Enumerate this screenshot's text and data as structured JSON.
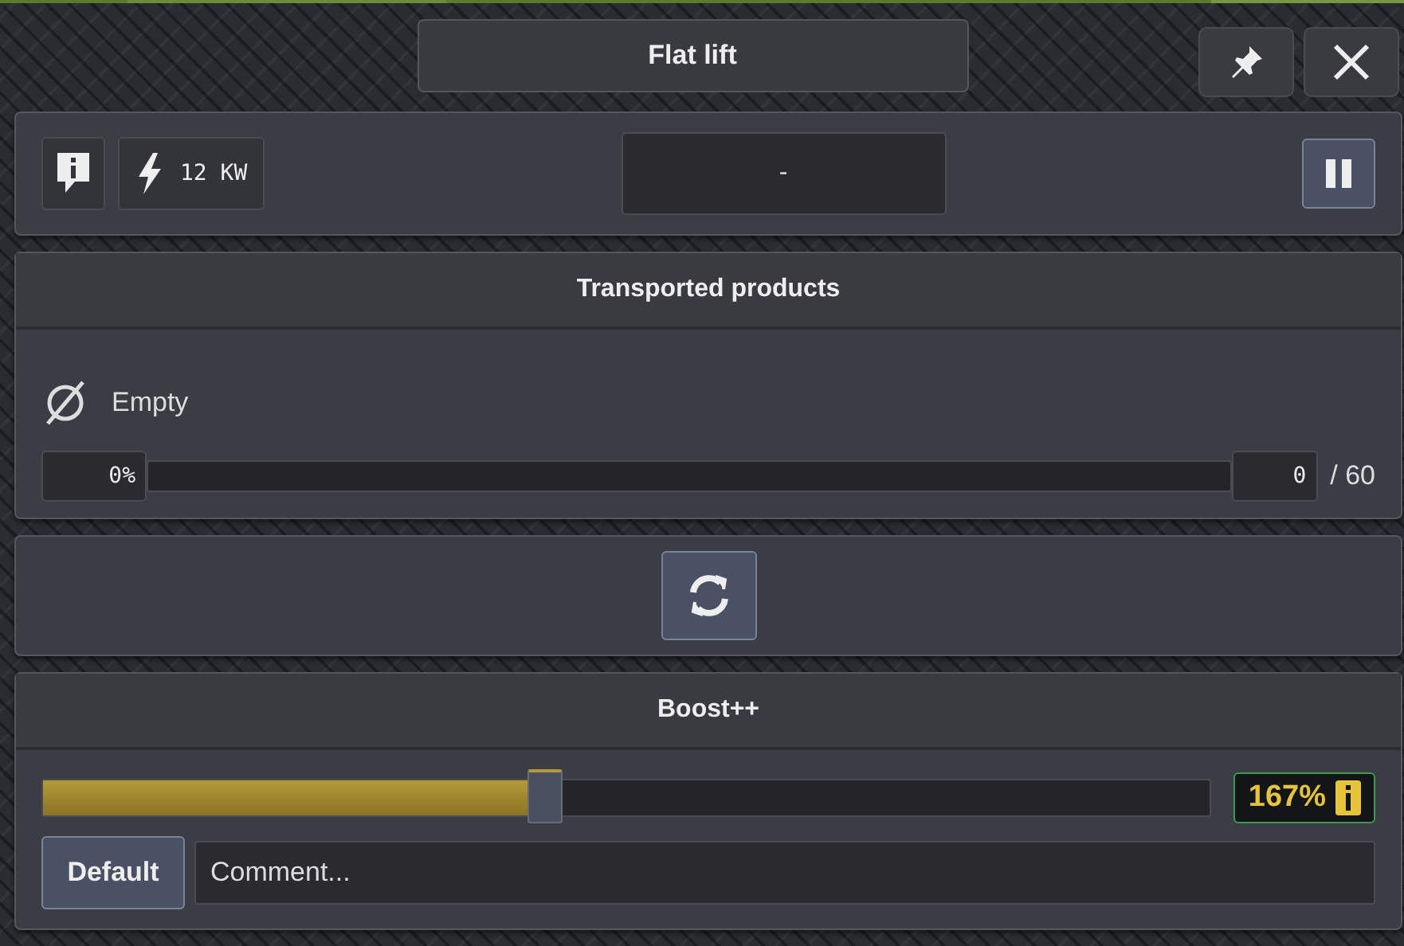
{
  "window": {
    "title": "Flat lift"
  },
  "status_panel": {
    "power": "12 KW",
    "status": "-",
    "paused": true
  },
  "products": {
    "title": "Transported products",
    "empty_label": "Empty",
    "percent": "0%",
    "level": 0,
    "count": "0",
    "capacity": "/ 60"
  },
  "boost": {
    "title": "Boost++",
    "level": 0.43,
    "value": "167%",
    "default_button": "Default",
    "comment": {
      "placeholder": "Comment..."
    }
  }
}
